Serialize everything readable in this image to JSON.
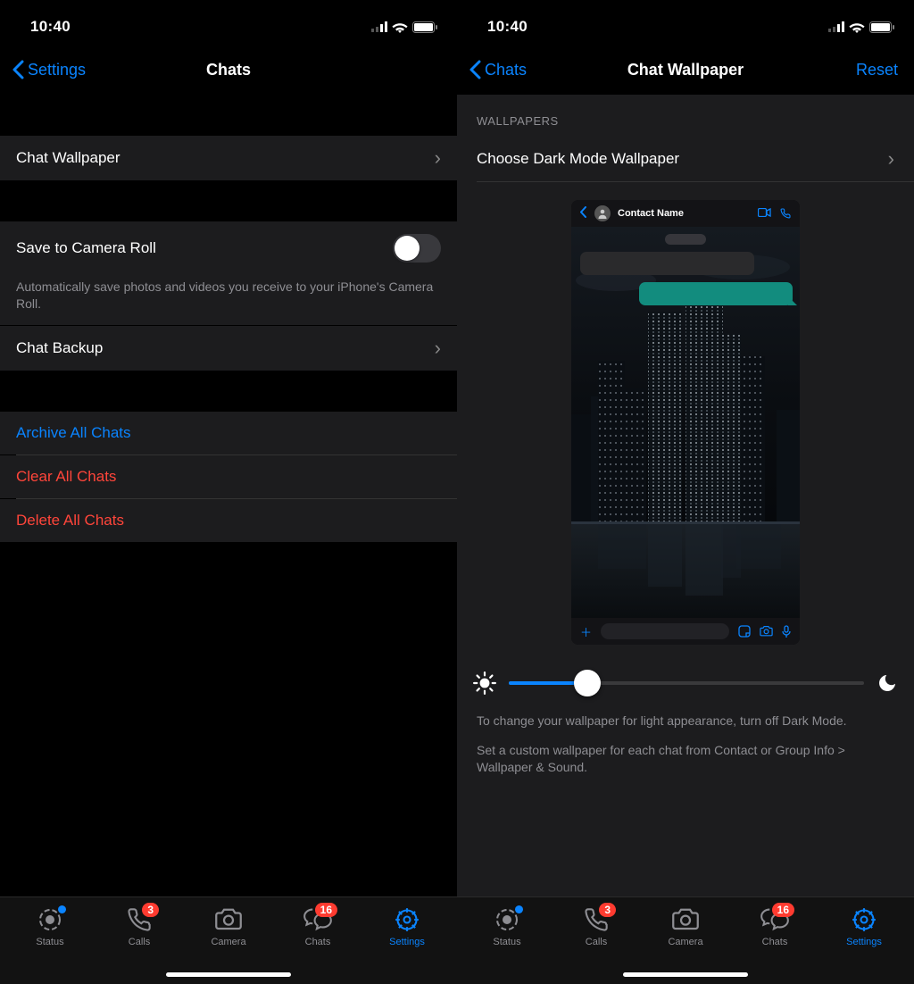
{
  "left": {
    "status_time": "10:40",
    "nav_back": "Settings",
    "nav_title": "Chats",
    "rows": {
      "chat_wallpaper": "Chat Wallpaper",
      "save_camera": "Save to Camera Roll",
      "save_footer": "Automatically save photos and videos you receive to your iPhone's Camera Roll.",
      "chat_backup": "Chat Backup",
      "archive": "Archive All Chats",
      "clear": "Clear All Chats",
      "delete": "Delete All Chats"
    }
  },
  "right": {
    "status_time": "10:40",
    "nav_back": "Chats",
    "nav_title": "Chat Wallpaper",
    "nav_right": "Reset",
    "section_header": "WALLPAPERS",
    "choose_row": "Choose Dark Mode Wallpaper",
    "preview": {
      "contact_name": "Contact Name"
    },
    "info1": "To change your wallpaper for light appearance, turn off Dark Mode.",
    "info2": "Set a custom wallpaper for each chat from Contact or Group Info > Wallpaper & Sound."
  },
  "tabbar": {
    "status": "Status",
    "calls": "Calls",
    "calls_badge": "3",
    "camera": "Camera",
    "chats": "Chats",
    "chats_badge": "16",
    "settings": "Settings"
  }
}
